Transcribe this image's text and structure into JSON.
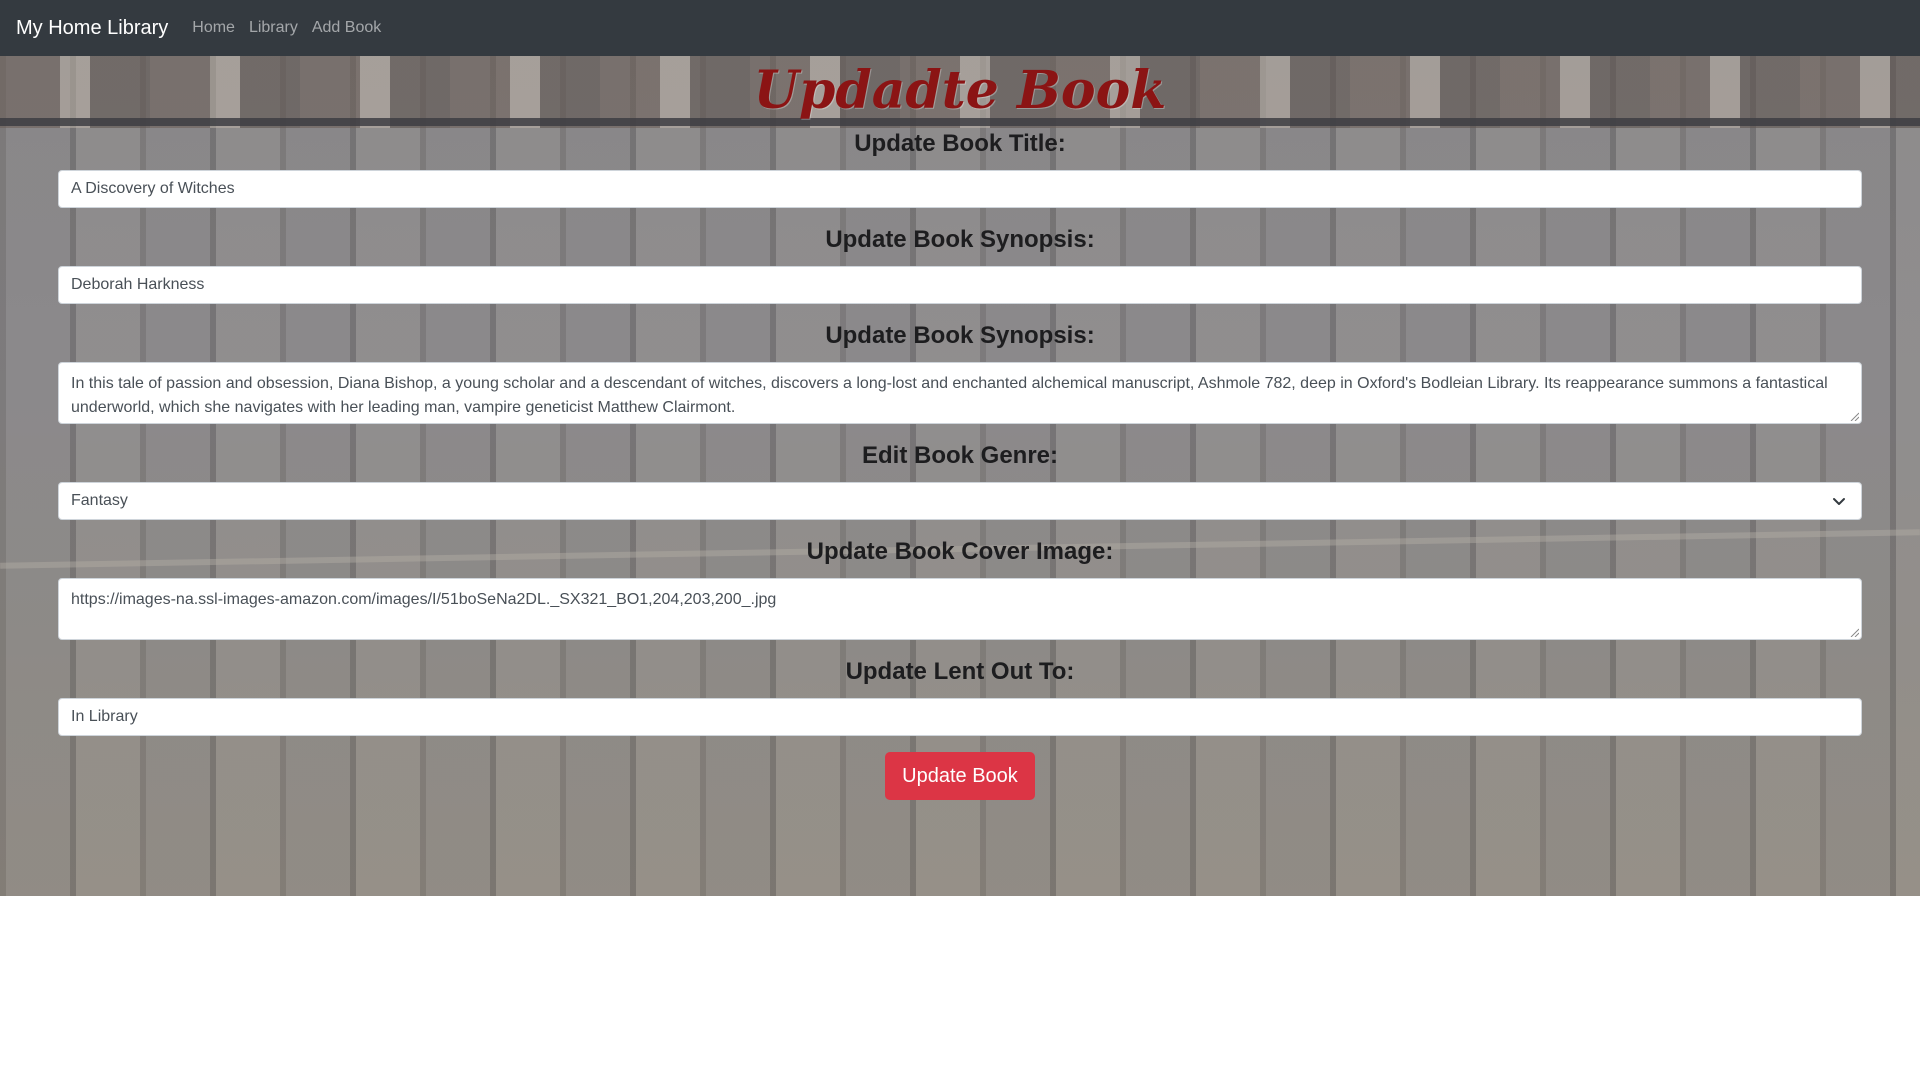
{
  "navbar": {
    "brand": "My Home Library",
    "links": [
      "Home",
      "Library",
      "Add Book"
    ]
  },
  "page": {
    "title": "Updadte Book"
  },
  "form": {
    "title_label": "Update Book Title:",
    "title_value": "A Discovery of Witches",
    "author_label": "Update Book Synopsis:",
    "author_value": "Deborah Harkness",
    "synopsis_label": "Update Book Synopsis:",
    "synopsis_value": "In this tale of passion and obsession, Diana Bishop, a young scholar and a descendant of witches, discovers a long-lost and enchanted alchemical manuscript, Ashmole 782, deep in Oxford's Bodleian Library. Its reappearance summons a fantastical underworld, which she navigates with her leading man, vampire geneticist Matthew Clairmont.",
    "genre_label": "Edit Book Genre:",
    "genre_value": "Fantasy",
    "cover_label": "Update Book Cover Image:",
    "cover_value": "https://images-na.ssl-images-amazon.com/images/I/51boSeNa2DL._SX321_BO1,204,203,200_.jpg",
    "lent_label": "Update Lent Out To:",
    "lent_value": "In Library",
    "submit_label": "Update Book"
  },
  "icons": {
    "select_arrow": "chevron-down-icon",
    "resize_handle": "resize-grip-icon"
  },
  "colors": {
    "navbar_bg": "#343a40",
    "title_color": "#8b1414",
    "button_bg": "#dc3545"
  }
}
